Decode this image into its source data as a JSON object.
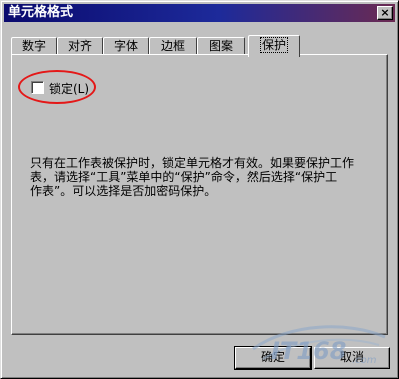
{
  "window": {
    "title": "单元格格式",
    "close_glyph": "×"
  },
  "tabs": [
    {
      "label": "数字",
      "active": false
    },
    {
      "label": "对齐",
      "active": false
    },
    {
      "label": "字体",
      "active": false
    },
    {
      "label": "边框",
      "active": false
    },
    {
      "label": "图案",
      "active": false
    },
    {
      "label": "保护",
      "active": true
    }
  ],
  "protection": {
    "lock_label": "锁定(L)",
    "lock_checked": false,
    "description_line1": "只有在工作表被保护时，锁定单元格才有效。如果要保护工作",
    "description_line2": "表，请选择“工具”菜单中的“保护”命令，然后选择“保护工",
    "description_line3": "作表”。可以选择是否加密码保护。"
  },
  "buttons": {
    "ok_label": "确定",
    "cancel_label": "取消"
  },
  "watermark": {
    "text": "IT168",
    "suffix": ".com"
  },
  "colors": {
    "highlight": "#e41818",
    "titlebar_start": "#0a0a6e",
    "titlebar_end": "#6b2a52"
  }
}
